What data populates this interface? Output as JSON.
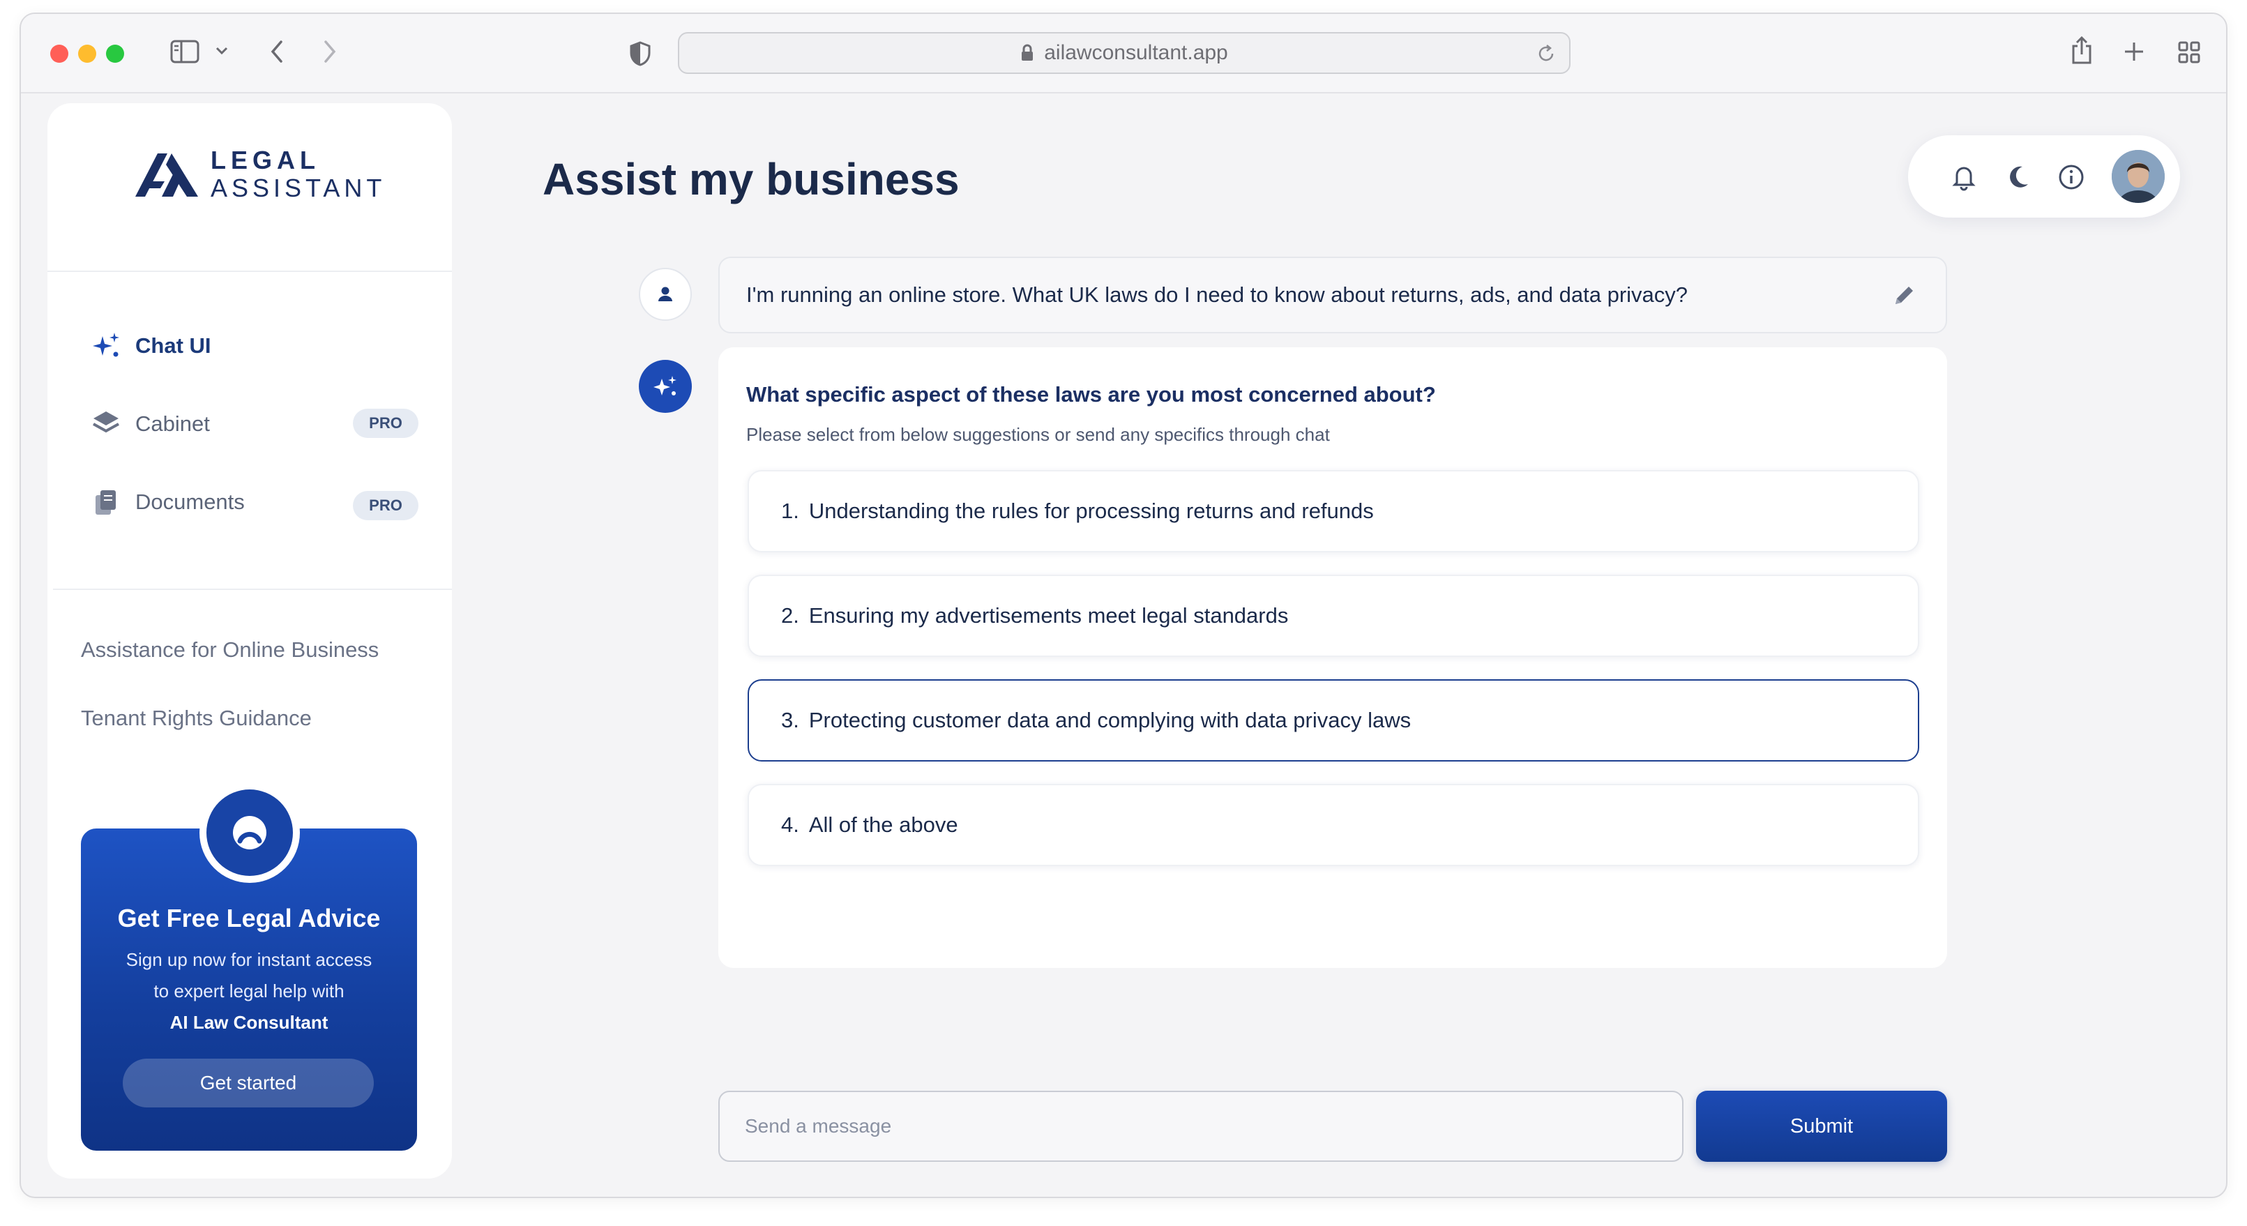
{
  "browser": {
    "url": "ailawconsultant.app",
    "colors": {
      "close": "#ff5f57",
      "minimize": "#febc2e",
      "zoom": "#28c840"
    }
  },
  "sidebar": {
    "logo": {
      "line1": "LEGAL",
      "line2": "ASSISTANT"
    },
    "nav": [
      {
        "label": "Chat UI",
        "icon": "sparkle-icon",
        "active": true
      },
      {
        "label": "Cabinet",
        "icon": "layers-icon",
        "badge": "PRO"
      },
      {
        "label": "Documents",
        "icon": "documents-icon",
        "badge": "PRO"
      }
    ],
    "history": [
      "Assistance for Online Business",
      "Tenant Rights Guidance"
    ],
    "promo": {
      "title": "Get Free Legal Advice",
      "text_line1": "Sign up now for instant access",
      "text_line2": "to expert legal help with",
      "text_bold": "AI Law Consultant",
      "button": "Get started"
    }
  },
  "header": {
    "title": "Assist my business",
    "icons": [
      "bell-icon",
      "moon-icon",
      "info-icon",
      "avatar"
    ]
  },
  "chat": {
    "user_message": "I'm running an online store. What UK laws do I need to know about returns, ads, and data privacy?",
    "assistant": {
      "question": "What specific aspect of these laws are you most concerned about?",
      "subtitle": "Please select from below suggestions or send any specifics through chat",
      "options": [
        {
          "num": "1.",
          "text": "Understanding the rules for processing returns and refunds"
        },
        {
          "num": "2.",
          "text": "Ensuring my advertisements meet legal standards"
        },
        {
          "num": "3.",
          "text": "Protecting customer data and complying with data privacy laws",
          "selected": true
        },
        {
          "num": "4.",
          "text": "All of the above"
        }
      ]
    }
  },
  "composer": {
    "placeholder": "Send a message",
    "submit": "Submit"
  },
  "theme": {
    "primary": "#1d4bb5",
    "navy": "#1b2f63",
    "background": "#f4f4f6"
  }
}
